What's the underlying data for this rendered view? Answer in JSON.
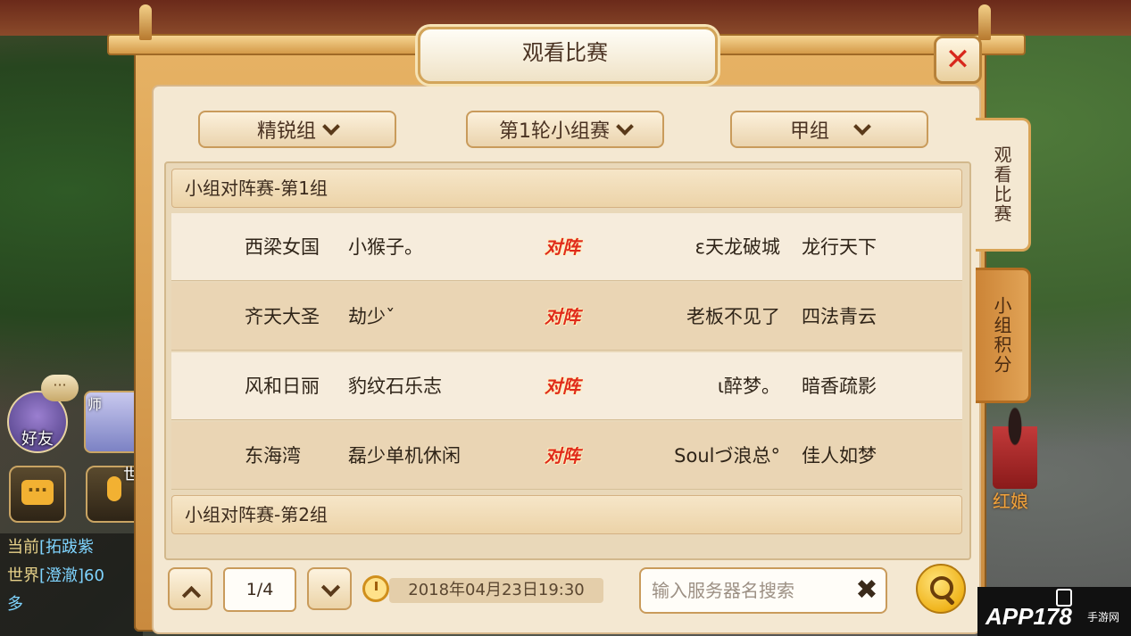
{
  "window": {
    "title": "观看比赛",
    "close_label": "✕"
  },
  "side_tabs": [
    {
      "label": "观看比赛",
      "active": true
    },
    {
      "label": "小组积分",
      "active": false
    }
  ],
  "filters": {
    "division": "精锐组",
    "round": "第1轮小组赛",
    "group": "甲组"
  },
  "groups": [
    {
      "header": "小组对阵赛-第1组",
      "matches": [
        {
          "left_server": "西梁女国",
          "left_player": "小猴子。",
          "vs_label": "对阵",
          "right_player": "ε天龙破城",
          "right_server": "龙行天下"
        },
        {
          "left_server": "齐天大圣",
          "left_player": "劫少ˇ",
          "vs_label": "对阵",
          "right_player": "老板不见了",
          "right_server": "四法青云"
        },
        {
          "left_server": "风和日丽",
          "left_player": "豹纹石乐志",
          "vs_label": "对阵",
          "right_player": "ι醉梦。",
          "right_server": "暗香疏影"
        },
        {
          "left_server": "东海湾",
          "left_player": "磊少单机休闲",
          "vs_label": "对阵",
          "right_player": "Soulづ浪总°",
          "right_server": "佳人如梦"
        }
      ]
    },
    {
      "header": "小组对阵赛-第2组",
      "matches": []
    }
  ],
  "pagination": {
    "page": "1/4"
  },
  "datetime": "2018年04月23日19:30",
  "search": {
    "placeholder": "输入服务器名搜索",
    "clear_label": "✖"
  },
  "hud": {
    "friend_label": "好友",
    "friend_bubble": "···",
    "master_label": "师",
    "world_channel_label": "世",
    "chat_lines": [
      {
        "tag": "当前",
        "text": "[拓跋紫"
      },
      {
        "tag": "世界",
        "text": "[澄澈]60"
      },
      {
        "tag": "",
        "text": "多"
      }
    ],
    "npc_name": "红娘"
  },
  "watermark": {
    "brand": "APP178",
    "sub": "手游网"
  },
  "colors": {
    "accent_red": "#e02a1a",
    "panel_bg": "#f4e8d2",
    "frame_gold": "#d49a48"
  },
  "icons": [
    "close-icon",
    "chevron-down-icon",
    "chevron-up-icon",
    "clock-icon",
    "search-icon",
    "clear-icon",
    "chat-icon",
    "microphone-icon"
  ]
}
